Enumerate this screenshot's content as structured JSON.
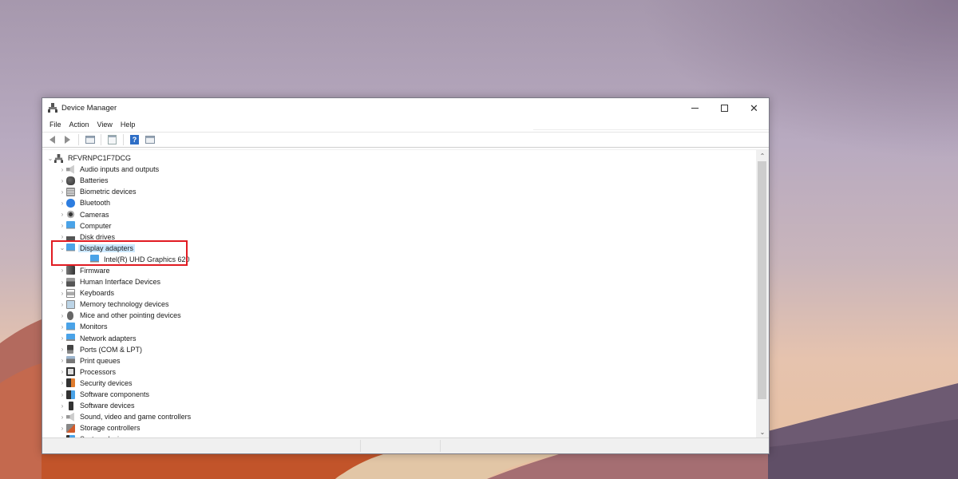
{
  "window": {
    "title": "Device Manager",
    "controls": {
      "minimize": "minimize",
      "maximize": "maximize",
      "close": "✕"
    }
  },
  "menu": [
    {
      "label": "File"
    },
    {
      "label": "Action"
    },
    {
      "label": "View"
    },
    {
      "label": "Help"
    }
  ],
  "toolbar": [
    {
      "name": "back-button",
      "icon": "back-arrow-icon"
    },
    {
      "name": "forward-button",
      "icon": "forward-arrow-icon"
    },
    {
      "name": "show-hide-console-tree-button",
      "icon": "console-tree-icon"
    },
    {
      "name": "properties-button",
      "icon": "properties-icon"
    },
    {
      "name": "help-button",
      "icon": "help-icon",
      "glyph": "?"
    },
    {
      "name": "show-action-pane-button",
      "icon": "action-pane-icon"
    }
  ],
  "tree": {
    "root": {
      "label": "RFVRNPC1F7DCG",
      "expanded": true,
      "chevron": "⌄",
      "icon": "computer-icon"
    },
    "collapsed_chevron": "›",
    "expanded_chevron": "⌄",
    "categories": [
      {
        "label": "Audio inputs and outputs",
        "icon": "speaker-icon",
        "expanded": false
      },
      {
        "label": "Batteries",
        "icon": "battery-icon",
        "expanded": false
      },
      {
        "label": "Biometric devices",
        "icon": "fingerprint-icon",
        "expanded": false
      },
      {
        "label": "Bluetooth",
        "icon": "bluetooth-icon",
        "expanded": false
      },
      {
        "label": "Cameras",
        "icon": "camera-icon",
        "expanded": false
      },
      {
        "label": "Computer",
        "icon": "monitor-icon",
        "expanded": false
      },
      {
        "label": "Disk drives",
        "icon": "disk-drive-icon",
        "expanded": false
      },
      {
        "label": "Display adapters",
        "icon": "display-adapter-icon",
        "expanded": true,
        "selected": true,
        "children": [
          {
            "label": "Intel(R) UHD Graphics 620",
            "icon": "display-adapter-icon"
          }
        ]
      },
      {
        "label": "Firmware",
        "icon": "firmware-icon",
        "expanded": false
      },
      {
        "label": "Human Interface Devices",
        "icon": "hid-icon",
        "expanded": false
      },
      {
        "label": "Keyboards",
        "icon": "keyboard-icon",
        "expanded": false
      },
      {
        "label": "Memory technology devices",
        "icon": "memory-icon",
        "expanded": false
      },
      {
        "label": "Mice and other pointing devices",
        "icon": "mouse-icon",
        "expanded": false
      },
      {
        "label": "Monitors",
        "icon": "monitor-icon",
        "expanded": false
      },
      {
        "label": "Network adapters",
        "icon": "network-adapter-icon",
        "expanded": false
      },
      {
        "label": "Ports (COM & LPT)",
        "icon": "port-icon",
        "expanded": false
      },
      {
        "label": "Print queues",
        "icon": "printer-icon",
        "expanded": false
      },
      {
        "label": "Processors",
        "icon": "processor-icon",
        "expanded": false
      },
      {
        "label": "Security devices",
        "icon": "security-device-icon",
        "expanded": false
      },
      {
        "label": "Software components",
        "icon": "software-component-icon",
        "expanded": false
      },
      {
        "label": "Software devices",
        "icon": "software-device-icon",
        "expanded": false
      },
      {
        "label": "Sound, video and game controllers",
        "icon": "speaker-icon",
        "expanded": false
      },
      {
        "label": "Storage controllers",
        "icon": "storage-controller-icon",
        "expanded": false
      },
      {
        "label": "System devices",
        "icon": "system-device-icon",
        "expanded": false
      }
    ]
  },
  "scrollbar": {
    "up": "⌃",
    "down": "⌄",
    "position": 0.0
  },
  "annotation": {
    "highlight_color": "#e11b22",
    "target": "Display adapters"
  },
  "colors": {
    "selection": "#cce8ff",
    "accent_blue": "#2e6ec6"
  }
}
